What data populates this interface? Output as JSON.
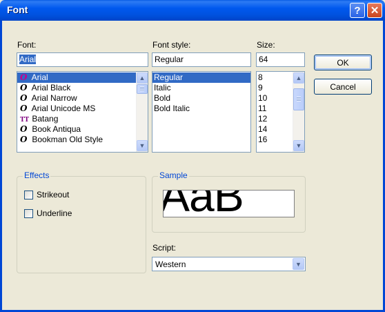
{
  "window": {
    "title": "Font",
    "help_label": "?",
    "close_label": "✕"
  },
  "font": {
    "label": "Font:",
    "value": "Arial",
    "items": [
      {
        "icon": "O",
        "label": "Arial"
      },
      {
        "icon": "O",
        "label": "Arial Black"
      },
      {
        "icon": "O",
        "label": "Arial Narrow"
      },
      {
        "icon": "O",
        "label": "Arial Unicode MS"
      },
      {
        "icon": "TT",
        "label": "Batang"
      },
      {
        "icon": "O",
        "label": "Book Antiqua"
      },
      {
        "icon": "O",
        "label": "Bookman Old Style"
      }
    ]
  },
  "style": {
    "label": "Font style:",
    "value": "Regular",
    "items": [
      "Regular",
      "Italic",
      "Bold",
      "Bold Italic"
    ]
  },
  "size": {
    "label": "Size:",
    "value": "64",
    "items": [
      "8",
      "9",
      "10",
      "11",
      "12",
      "14",
      "16"
    ]
  },
  "buttons": {
    "ok": "OK",
    "cancel": "Cancel"
  },
  "effects": {
    "title": "Effects",
    "strikeout": "Strikeout",
    "underline": "Underline"
  },
  "sample": {
    "title": "Sample",
    "text": "AaB"
  },
  "script": {
    "label": "Script:",
    "value": "Western"
  },
  "colors": {
    "titlebar": "#0054e3",
    "selection": "#316ac5",
    "group_title": "#0046d5",
    "dialog_bg": "#ece9d8"
  }
}
